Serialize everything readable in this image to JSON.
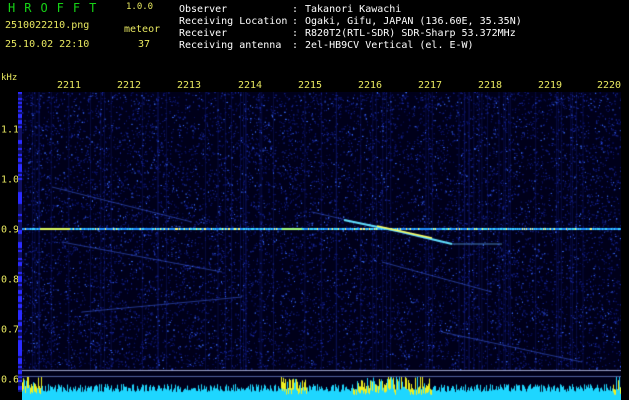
{
  "app": {
    "title": "HROFFT",
    "version": "1.0.0"
  },
  "file": {
    "name": "2510022210.png",
    "mode": "meteor",
    "timestamp": "25.10.02 22:10",
    "count": "37"
  },
  "info": [
    {
      "label": "Observer",
      "value": "Takanori Kawachi"
    },
    {
      "label": "Receiving Location",
      "value": "Ogaki, Gifu, JAPAN (136.60E, 35.35N)"
    },
    {
      "label": "Receiver",
      "value": "R820T2(RTL-SDR) SDR-Sharp 53.372MHz"
    },
    {
      "label": "Receiving antenna",
      "value": "2el-HB9CV Vertical (el. E-W)"
    }
  ],
  "axes": {
    "unit": "kHz",
    "x_ticks": [
      "2211",
      "2212",
      "2213",
      "2214",
      "2215",
      "2216",
      "2217",
      "2218",
      "2219",
      "2220"
    ],
    "y_ticks": [
      "1.1",
      "1.0",
      "0.9",
      "0.8",
      "0.7",
      "0.6"
    ]
  },
  "colors": {
    "header_title": "#16d216",
    "header_text": "#e8e860",
    "info_text": "#ffffff",
    "carrier": "#2ad0ff",
    "activity_bar": "#22e0ff",
    "activity_peak": "#f0f020"
  }
}
